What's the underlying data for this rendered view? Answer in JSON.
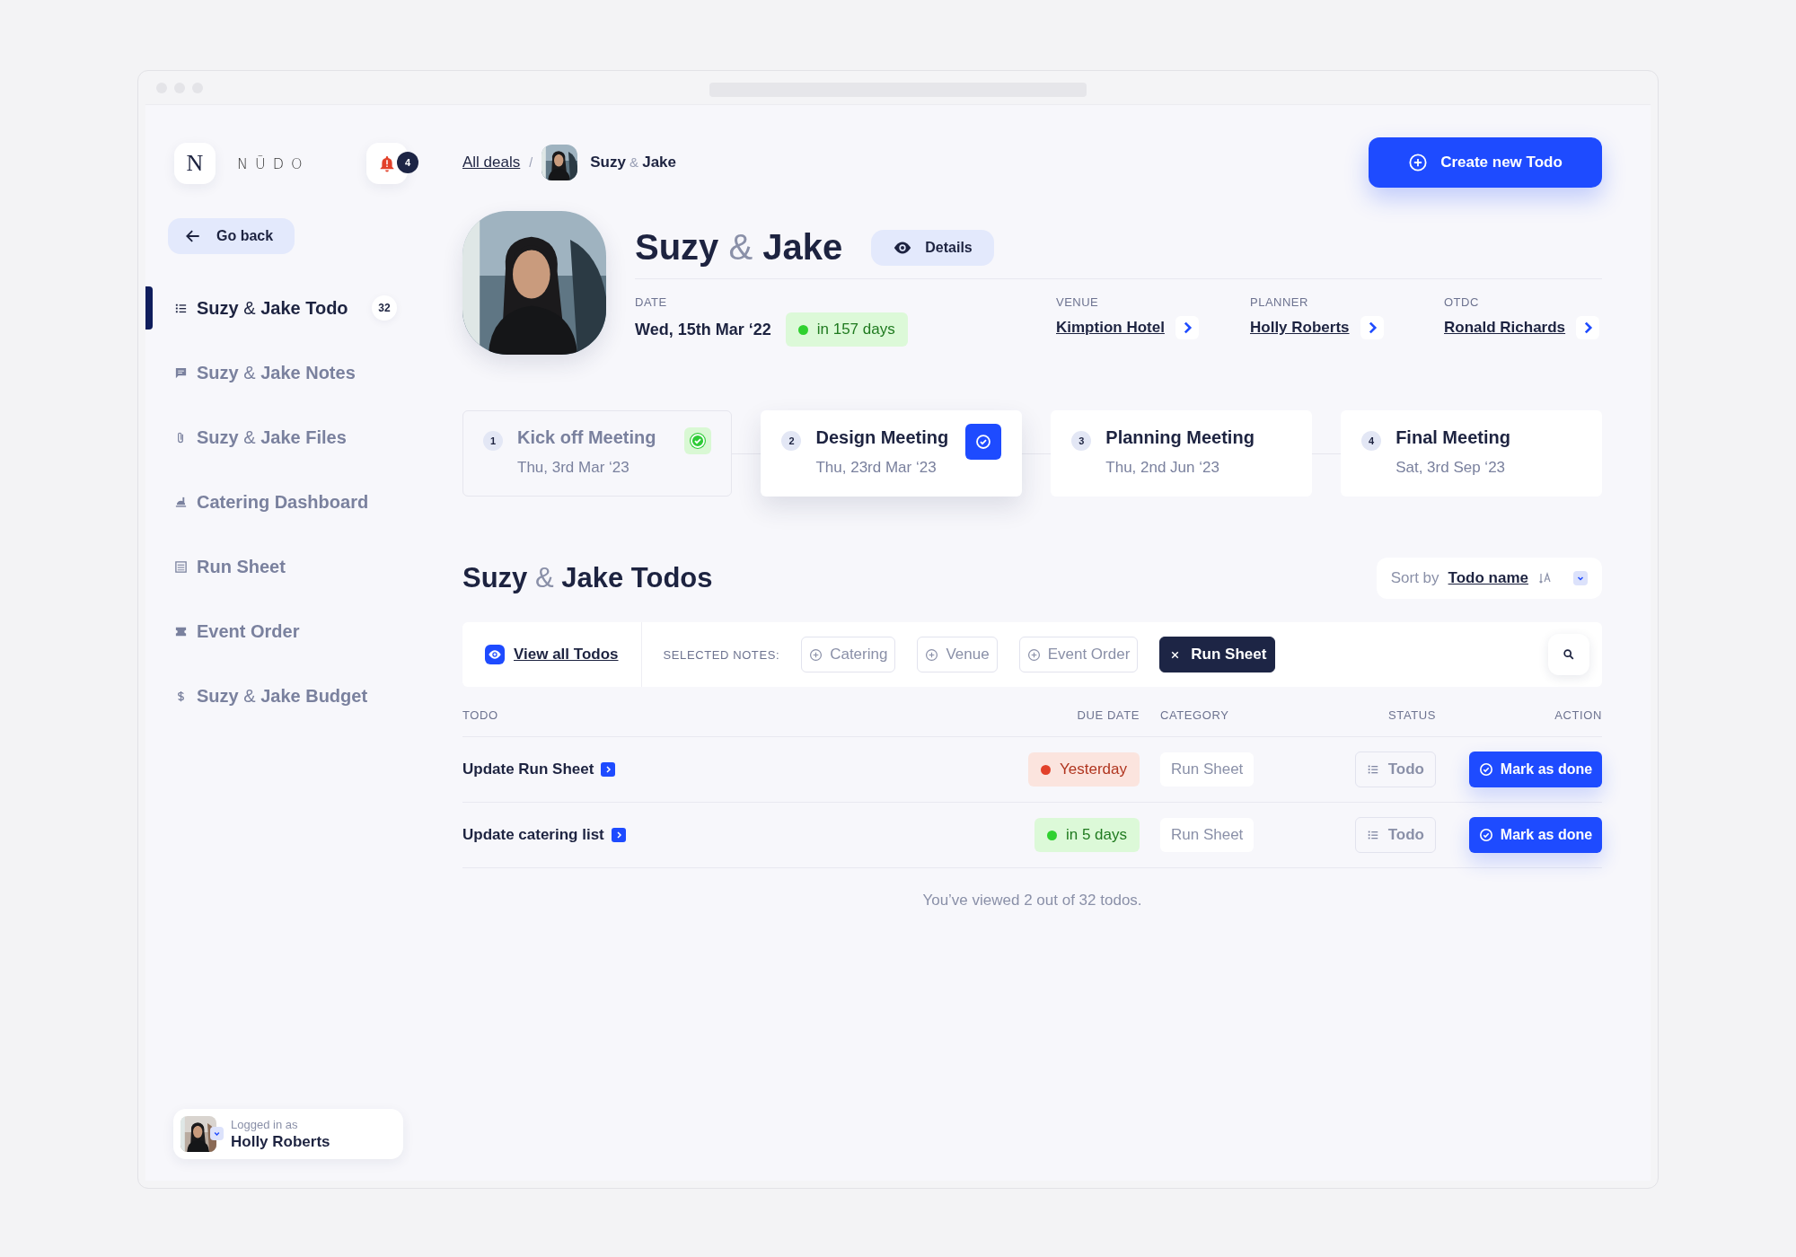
{
  "logo": {
    "mark": "N",
    "wordmark": "NŪDO"
  },
  "notifications": {
    "count": "4"
  },
  "back_button": {
    "label": "Go back"
  },
  "sidebar": {
    "items": [
      {
        "label": "**Suzy** & **Jake Todo**",
        "selected": true,
        "count": "32"
      },
      {
        "label": "**Suzy** & **Jake Notes**",
        "selected": false
      },
      {
        "label": "**Suzy** & **Jake Files**",
        "selected": false
      },
      {
        "label": "**Catering Dashboard**",
        "selected": false
      },
      {
        "label": "**Run Sheet**",
        "selected": false
      },
      {
        "label": "**Event Order**",
        "selected": false
      },
      {
        "label": "**Suzy** & **Jake Budget**",
        "selected": false
      }
    ]
  },
  "user": {
    "caption": "Logged in as",
    "name": "Holly Roberts"
  },
  "breadcrumb": {
    "link": "All deals",
    "separator": "/",
    "current": "**Suzy** & **Jake**"
  },
  "create_button": {
    "label": "Create new Todo"
  },
  "deal": {
    "title": "**Suzy** & **Jake**",
    "details_button": "Details",
    "date_label": "DATE",
    "date": "Wed, 15th Mar ‘22",
    "countdown": "in 157 days",
    "fields": [
      {
        "label": "VENUE",
        "value": "Kimption Hotel"
      },
      {
        "label": "PLANNER",
        "value": "Holly Roberts"
      },
      {
        "label": "OTDC",
        "value": "Ronald Richards"
      }
    ]
  },
  "meetings": [
    {
      "number": "1",
      "title": "Kick off Meeting",
      "date": "Thu, 3rd Mar ‘23",
      "completed": true,
      "selected": false
    },
    {
      "number": "2",
      "title": "Design Meeting",
      "date": "Thu, 23rd Mar ‘23",
      "completed": false,
      "selected": true
    },
    {
      "number": "3",
      "title": "Planning Meeting",
      "date": "Thu, 2nd Jun ‘23",
      "completed": false,
      "selected": false
    },
    {
      "number": "4",
      "title": "Final Meeting",
      "date": "Sat, 3rd Sep ‘23",
      "completed": false,
      "selected": false
    }
  ],
  "todos": {
    "title": "**Suzy** & **Jake Todos**",
    "sort_label": "Sort by",
    "sort_value": "Todo name",
    "view_all": "View all Todos",
    "notes_label": "SELECTED NOTES:",
    "notes": [
      {
        "label": "Catering",
        "selected": false
      },
      {
        "label": "Venue",
        "selected": false
      },
      {
        "label": "Event Order",
        "selected": false
      },
      {
        "label": "Run Sheet",
        "selected": true
      }
    ],
    "columns": [
      "TODO",
      "DUE DATE",
      "CATEGORY",
      "STATUS",
      "ACTION"
    ],
    "rows": [
      {
        "title": "Update Run Sheet",
        "due": {
          "text": "Yesterday",
          "kind": "overdue",
          "color": "#e2412a"
        },
        "category": "Run Sheet",
        "status": "Todo",
        "action": "Mark as done"
      },
      {
        "title": "Update catering list",
        "due": {
          "text": "in 5 days",
          "kind": "soon",
          "color": "#2fd12f"
        },
        "category": "Run Sheet",
        "status": "Todo",
        "action": "Mark as done"
      }
    ],
    "footer": "You’ve viewed 2 out of 32 todos."
  }
}
